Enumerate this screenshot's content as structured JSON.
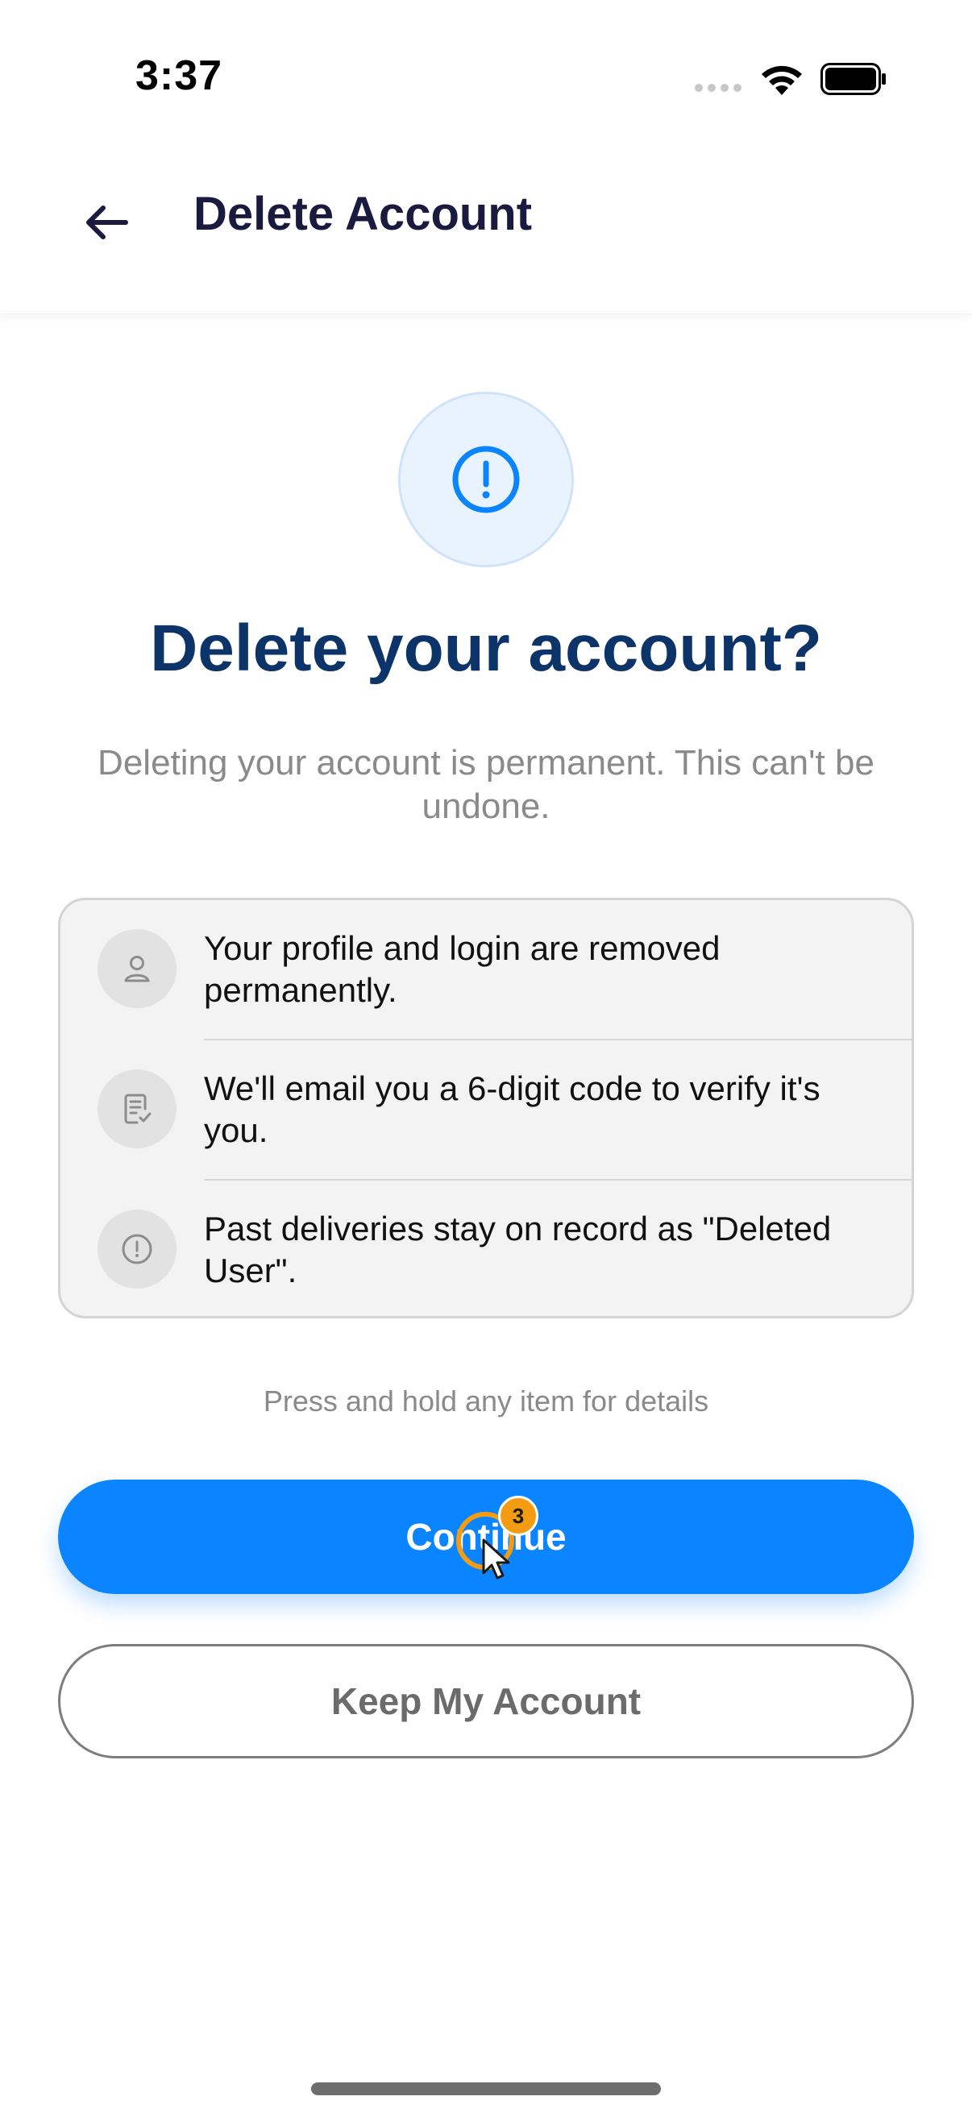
{
  "status_bar": {
    "time": "3:37"
  },
  "header": {
    "title": "Delete Account",
    "back_icon": "arrow-left-icon"
  },
  "hero": {
    "icon": "exclamation-circle-icon",
    "heading": "Delete your account?",
    "subtext": "Deleting your account is permanent. This can't be undone."
  },
  "info_items": [
    {
      "icon": "user-icon",
      "text": "Your profile and login are removed permanently."
    },
    {
      "icon": "document-check-icon",
      "text": "We'll email you a 6-digit code to verify it's you."
    },
    {
      "icon": "exclamation-circle-icon",
      "text": "Past deliveries stay on record as \"Deleted User\"."
    }
  ],
  "hint": "Press and hold any item for details",
  "buttons": {
    "continue_label": "Continue",
    "keep_label": "Keep My Account"
  },
  "cursor": {
    "step_badge": "3"
  },
  "colors": {
    "accent": "#0a84ff",
    "heading": "#0d3468",
    "step_badge": "#f39c12"
  }
}
